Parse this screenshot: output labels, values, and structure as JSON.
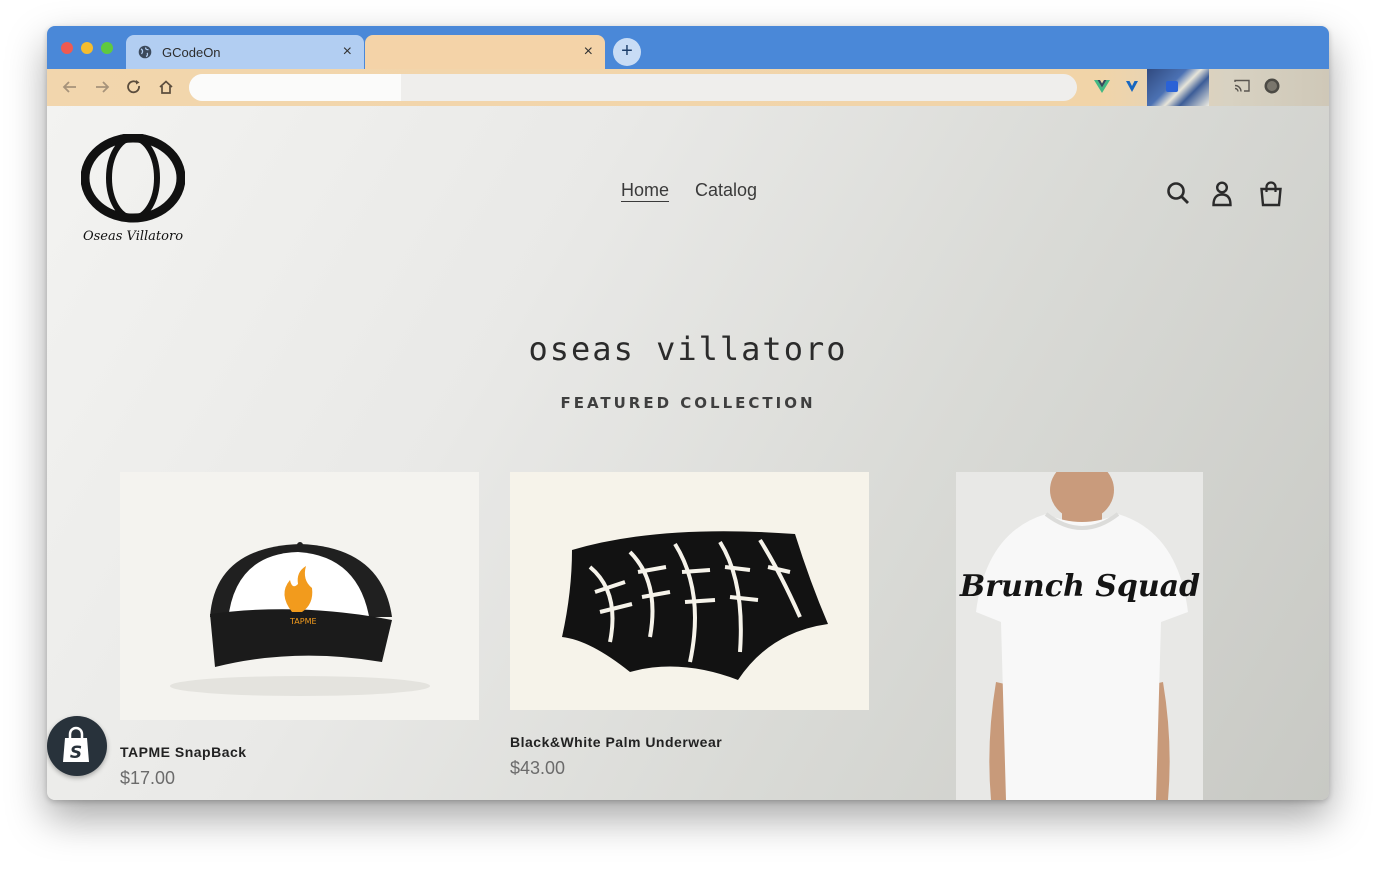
{
  "browser": {
    "tabs": [
      {
        "title": "GCodeOn",
        "close": "×",
        "icon": "globe-icon"
      },
      {
        "title": "",
        "close": "×"
      }
    ],
    "new_tab": "+",
    "nav_icons": [
      "back-arrow-icon",
      "forward-arrow-icon",
      "reload-icon",
      "home-icon"
    ],
    "address": "",
    "colors": {
      "tabstrip": "#4a88d8",
      "active_tab": "#b2cef2",
      "inactive_tab": "#f4d3a8"
    }
  },
  "store": {
    "logo_text": "Oseas Villatoro",
    "nav": [
      {
        "label": "Home"
      },
      {
        "label": "Catalog"
      }
    ],
    "header_icons": [
      "search-icon",
      "account-icon",
      "cart-icon"
    ],
    "title": "oseas villatoro",
    "section_label": "FEATURED COLLECTION",
    "products": [
      {
        "name": "TAPME SnapBack",
        "price": "$17.00",
        "image": "trucker-cap-image",
        "print": "TAPME"
      },
      {
        "name": "Black&White Palm Underwear",
        "price": "$43.00",
        "image": "palm-print-briefs-image"
      },
      {
        "name": "",
        "price": "",
        "image": "brunch-squad-tshirt-image",
        "print": "Brunch Squad"
      }
    ],
    "badge": "shopify-bag-icon"
  }
}
